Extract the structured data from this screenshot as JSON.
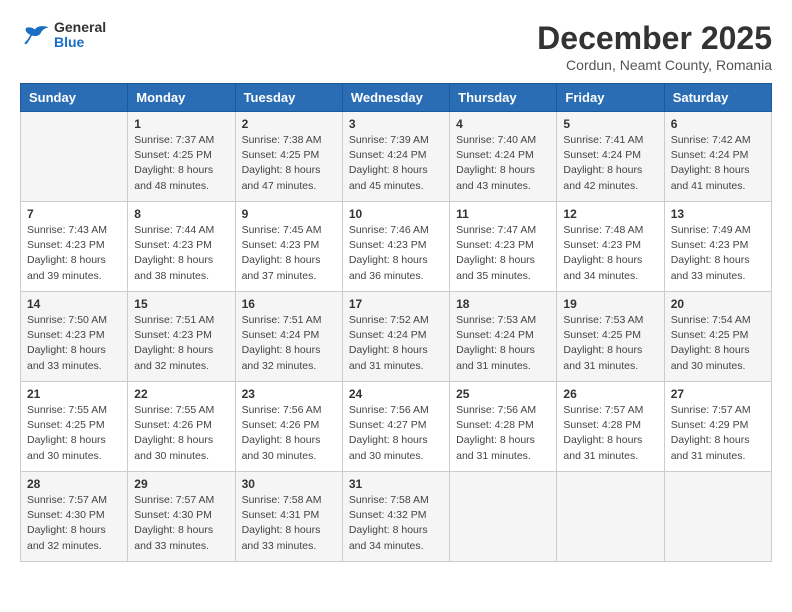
{
  "header": {
    "logo": {
      "general": "General",
      "blue": "Blue"
    },
    "title": "December 2025",
    "location": "Cordun, Neamt County, Romania"
  },
  "days_of_week": [
    "Sunday",
    "Monday",
    "Tuesday",
    "Wednesday",
    "Thursday",
    "Friday",
    "Saturday"
  ],
  "weeks": [
    [
      {
        "day": "",
        "info": ""
      },
      {
        "day": "1",
        "info": "Sunrise: 7:37 AM\nSunset: 4:25 PM\nDaylight: 8 hours and 48 minutes."
      },
      {
        "day": "2",
        "info": "Sunrise: 7:38 AM\nSunset: 4:25 PM\nDaylight: 8 hours and 47 minutes."
      },
      {
        "day": "3",
        "info": "Sunrise: 7:39 AM\nSunset: 4:24 PM\nDaylight: 8 hours and 45 minutes."
      },
      {
        "day": "4",
        "info": "Sunrise: 7:40 AM\nSunset: 4:24 PM\nDaylight: 8 hours and 43 minutes."
      },
      {
        "day": "5",
        "info": "Sunrise: 7:41 AM\nSunset: 4:24 PM\nDaylight: 8 hours and 42 minutes."
      },
      {
        "day": "6",
        "info": "Sunrise: 7:42 AM\nSunset: 4:24 PM\nDaylight: 8 hours and 41 minutes."
      }
    ],
    [
      {
        "day": "7",
        "info": "Sunrise: 7:43 AM\nSunset: 4:23 PM\nDaylight: 8 hours and 39 minutes."
      },
      {
        "day": "8",
        "info": "Sunrise: 7:44 AM\nSunset: 4:23 PM\nDaylight: 8 hours and 38 minutes."
      },
      {
        "day": "9",
        "info": "Sunrise: 7:45 AM\nSunset: 4:23 PM\nDaylight: 8 hours and 37 minutes."
      },
      {
        "day": "10",
        "info": "Sunrise: 7:46 AM\nSunset: 4:23 PM\nDaylight: 8 hours and 36 minutes."
      },
      {
        "day": "11",
        "info": "Sunrise: 7:47 AM\nSunset: 4:23 PM\nDaylight: 8 hours and 35 minutes."
      },
      {
        "day": "12",
        "info": "Sunrise: 7:48 AM\nSunset: 4:23 PM\nDaylight: 8 hours and 34 minutes."
      },
      {
        "day": "13",
        "info": "Sunrise: 7:49 AM\nSunset: 4:23 PM\nDaylight: 8 hours and 33 minutes."
      }
    ],
    [
      {
        "day": "14",
        "info": "Sunrise: 7:50 AM\nSunset: 4:23 PM\nDaylight: 8 hours and 33 minutes."
      },
      {
        "day": "15",
        "info": "Sunrise: 7:51 AM\nSunset: 4:23 PM\nDaylight: 8 hours and 32 minutes."
      },
      {
        "day": "16",
        "info": "Sunrise: 7:51 AM\nSunset: 4:24 PM\nDaylight: 8 hours and 32 minutes."
      },
      {
        "day": "17",
        "info": "Sunrise: 7:52 AM\nSunset: 4:24 PM\nDaylight: 8 hours and 31 minutes."
      },
      {
        "day": "18",
        "info": "Sunrise: 7:53 AM\nSunset: 4:24 PM\nDaylight: 8 hours and 31 minutes."
      },
      {
        "day": "19",
        "info": "Sunrise: 7:53 AM\nSunset: 4:25 PM\nDaylight: 8 hours and 31 minutes."
      },
      {
        "day": "20",
        "info": "Sunrise: 7:54 AM\nSunset: 4:25 PM\nDaylight: 8 hours and 30 minutes."
      }
    ],
    [
      {
        "day": "21",
        "info": "Sunrise: 7:55 AM\nSunset: 4:25 PM\nDaylight: 8 hours and 30 minutes."
      },
      {
        "day": "22",
        "info": "Sunrise: 7:55 AM\nSunset: 4:26 PM\nDaylight: 8 hours and 30 minutes."
      },
      {
        "day": "23",
        "info": "Sunrise: 7:56 AM\nSunset: 4:26 PM\nDaylight: 8 hours and 30 minutes."
      },
      {
        "day": "24",
        "info": "Sunrise: 7:56 AM\nSunset: 4:27 PM\nDaylight: 8 hours and 30 minutes."
      },
      {
        "day": "25",
        "info": "Sunrise: 7:56 AM\nSunset: 4:28 PM\nDaylight: 8 hours and 31 minutes."
      },
      {
        "day": "26",
        "info": "Sunrise: 7:57 AM\nSunset: 4:28 PM\nDaylight: 8 hours and 31 minutes."
      },
      {
        "day": "27",
        "info": "Sunrise: 7:57 AM\nSunset: 4:29 PM\nDaylight: 8 hours and 31 minutes."
      }
    ],
    [
      {
        "day": "28",
        "info": "Sunrise: 7:57 AM\nSunset: 4:30 PM\nDaylight: 8 hours and 32 minutes."
      },
      {
        "day": "29",
        "info": "Sunrise: 7:57 AM\nSunset: 4:30 PM\nDaylight: 8 hours and 33 minutes."
      },
      {
        "day": "30",
        "info": "Sunrise: 7:58 AM\nSunset: 4:31 PM\nDaylight: 8 hours and 33 minutes."
      },
      {
        "day": "31",
        "info": "Sunrise: 7:58 AM\nSunset: 4:32 PM\nDaylight: 8 hours and 34 minutes."
      },
      {
        "day": "",
        "info": ""
      },
      {
        "day": "",
        "info": ""
      },
      {
        "day": "",
        "info": ""
      }
    ]
  ]
}
